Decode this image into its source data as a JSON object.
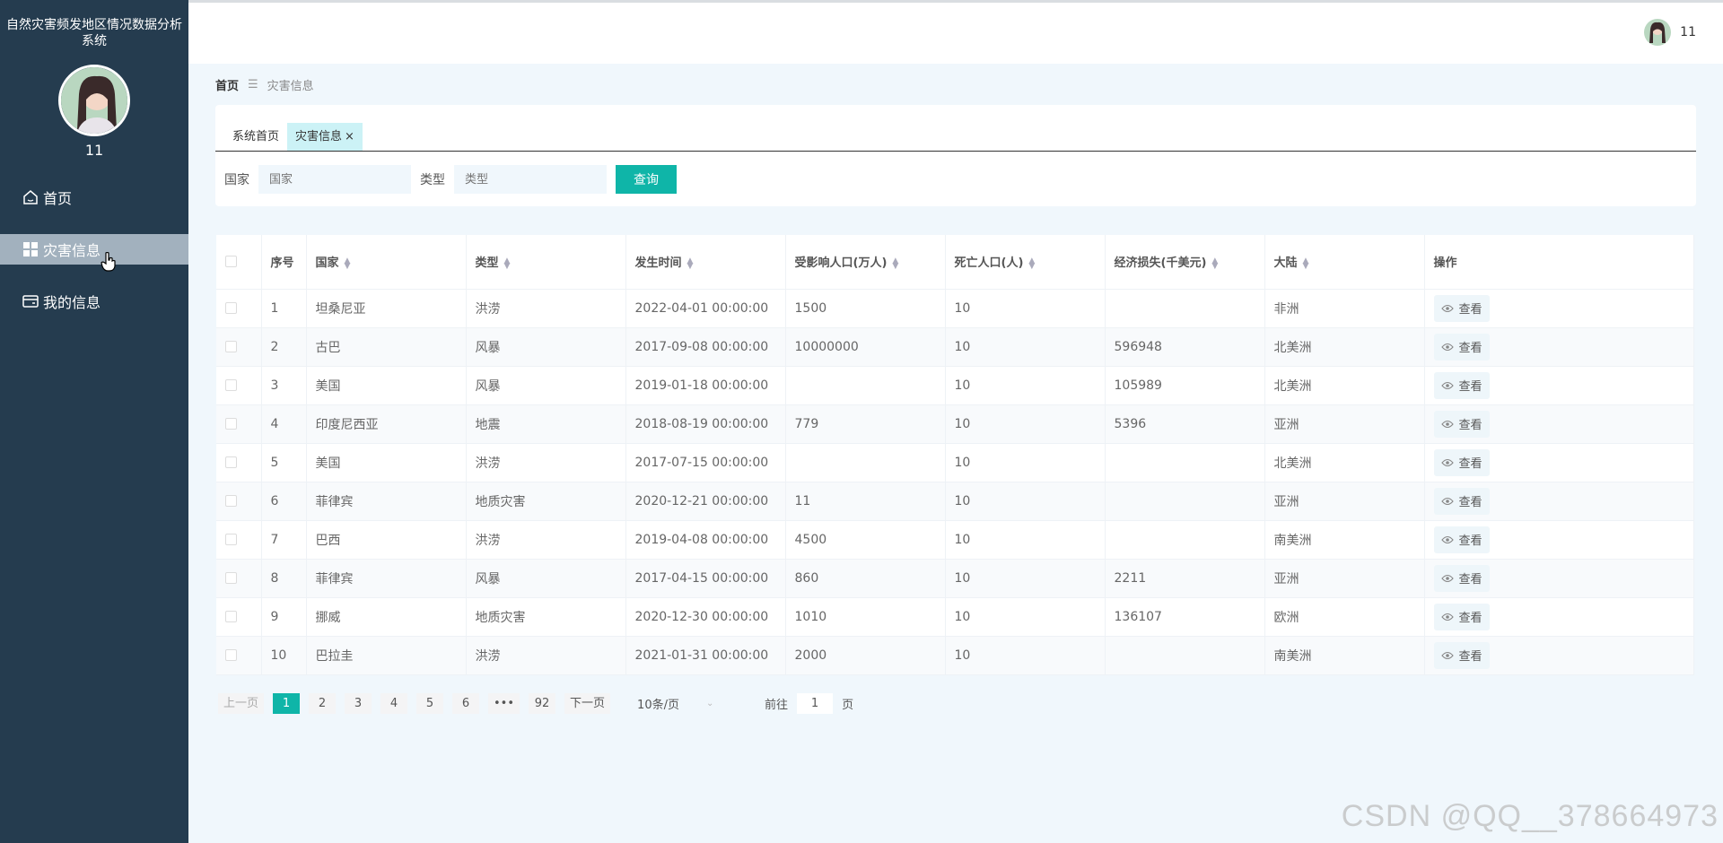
{
  "app": {
    "title": "自然灾害频发地区情况数据分析系统"
  },
  "user": {
    "name": "11"
  },
  "sidebar": {
    "items": [
      {
        "label": "首页",
        "icon": "home-icon",
        "active": false
      },
      {
        "label": "灾害信息",
        "icon": "grid-icon",
        "active": true
      },
      {
        "label": "我的信息",
        "icon": "card-icon",
        "active": false
      }
    ]
  },
  "breadcrumb": {
    "home": "首页",
    "separator": "☰",
    "current": "灾害信息"
  },
  "tabs": [
    {
      "label": "系统首页",
      "active": false
    },
    {
      "label": "灾害信息",
      "active": true,
      "close": "×"
    }
  ],
  "search": {
    "country_label": "国家",
    "country_placeholder": "国家",
    "type_label": "类型",
    "type_placeholder": "类型",
    "button": "查询"
  },
  "table": {
    "headers": [
      "序号",
      "国家",
      "类型",
      "发生时间",
      "受影响人口(万人)",
      "死亡人口(人)",
      "经济损失(千美元)",
      "大陆",
      "操作"
    ],
    "action_label": "查看",
    "rows": [
      [
        "1",
        "坦桑尼亚",
        "洪涝",
        "2022-04-01 00:00:00",
        "1500",
        "10",
        "",
        "非洲"
      ],
      [
        "2",
        "古巴",
        "风暴",
        "2017-09-08 00:00:00",
        "10000000",
        "10",
        "596948",
        "北美洲"
      ],
      [
        "3",
        "美国",
        "风暴",
        "2019-01-18 00:00:00",
        "",
        "10",
        "105989",
        "北美洲"
      ],
      [
        "4",
        "印度尼西亚",
        "地震",
        "2018-08-19 00:00:00",
        "779",
        "10",
        "5396",
        "亚洲"
      ],
      [
        "5",
        "美国",
        "洪涝",
        "2017-07-15 00:00:00",
        "",
        "10",
        "",
        "北美洲"
      ],
      [
        "6",
        "菲律宾",
        "地质灾害",
        "2020-12-21 00:00:00",
        "11",
        "10",
        "",
        "亚洲"
      ],
      [
        "7",
        "巴西",
        "洪涝",
        "2019-04-08 00:00:00",
        "4500",
        "10",
        "",
        "南美洲"
      ],
      [
        "8",
        "菲律宾",
        "风暴",
        "2017-04-15 00:00:00",
        "860",
        "10",
        "2211",
        "亚洲"
      ],
      [
        "9",
        "挪威",
        "地质灾害",
        "2020-12-30 00:00:00",
        "1010",
        "10",
        "136107",
        "欧洲"
      ],
      [
        "10",
        "巴拉圭",
        "洪涝",
        "2021-01-31 00:00:00",
        "2000",
        "10",
        "",
        "南美洲"
      ]
    ]
  },
  "pagination": {
    "prev": "上一页",
    "pages": [
      "1",
      "2",
      "3",
      "4",
      "5",
      "6"
    ],
    "ellipsis": "•••",
    "last": "92",
    "next": "下一页",
    "page_size": "10条/页",
    "goto_label": "前往",
    "goto_value": "1",
    "page_unit": "页",
    "current_page": 1
  },
  "watermark": "CSDN @QQ__378664973",
  "colors": {
    "sidebar": "#253c4f",
    "accent": "#0fb5a8",
    "active_menu": "#a2b1be",
    "background": "#f0f7fc"
  }
}
